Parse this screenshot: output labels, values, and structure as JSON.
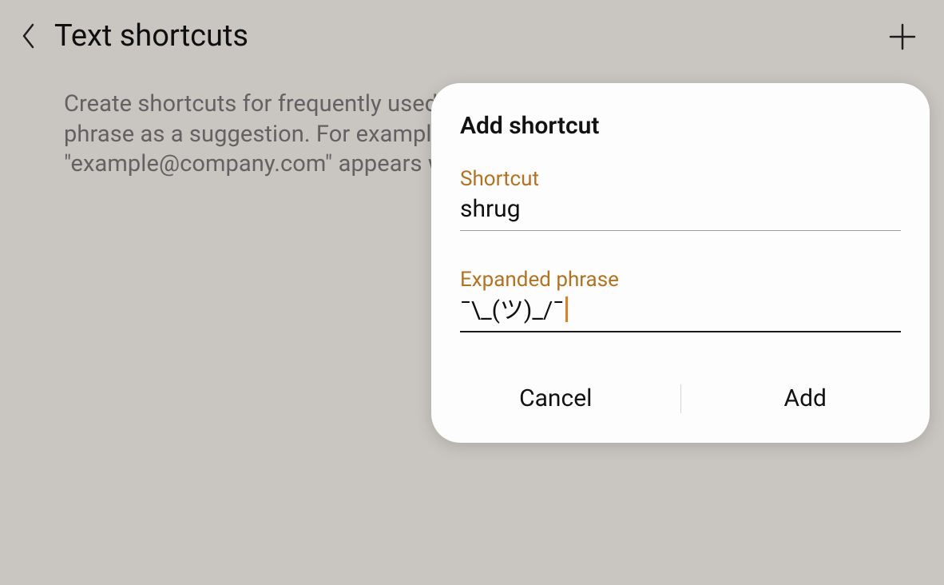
{
  "header": {
    "title": "Text shortcuts"
  },
  "description": "Create shortcuts for frequently used phrases. Entering a shortcut will add the phrase as a suggestion. For example, you could set \"email\" as a shortcut so that \"example@company.com\" appears whenever you type \"email.\"",
  "dialog": {
    "title": "Add shortcut",
    "shortcut_label": "Shortcut",
    "shortcut_value": "shrug",
    "expanded_label": "Expanded phrase",
    "expanded_value": "¯\\_(ツ)_/¯",
    "cancel": "Cancel",
    "add": "Add"
  }
}
